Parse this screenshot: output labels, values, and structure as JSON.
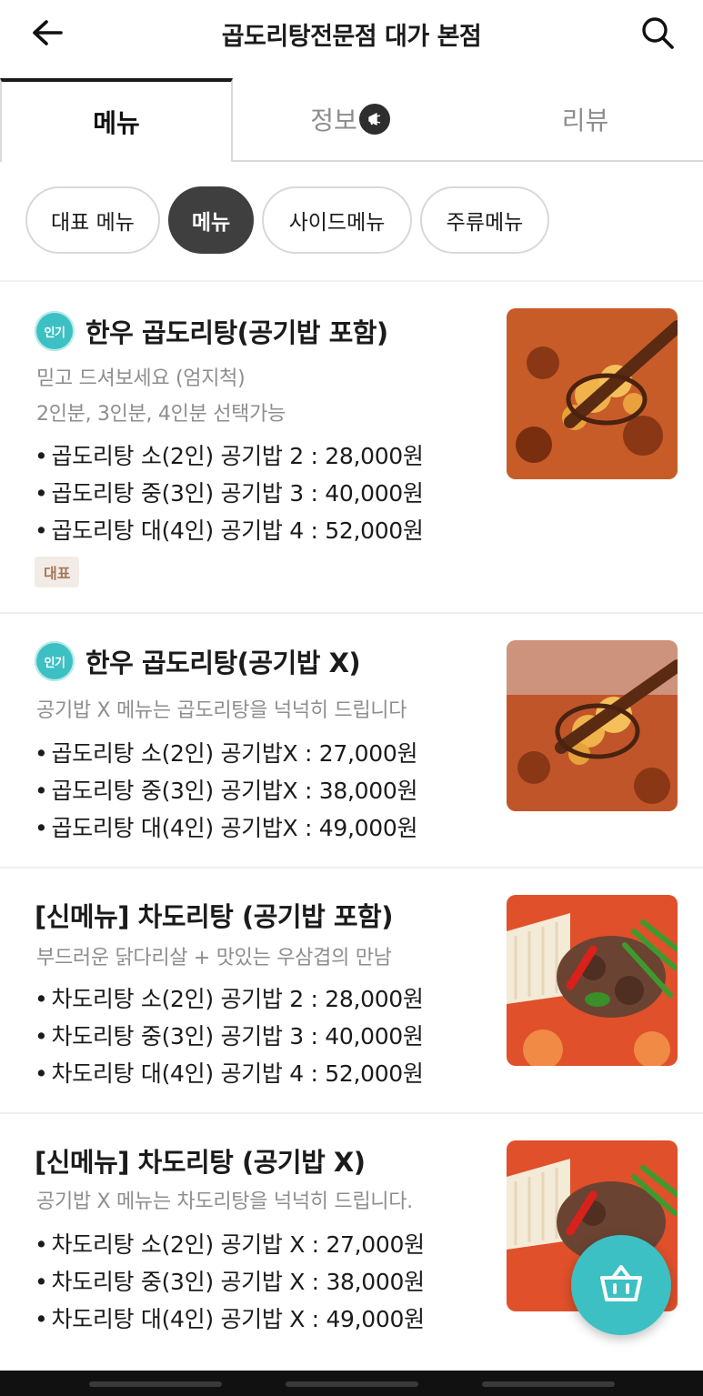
{
  "header": {
    "title": "곱도리탕전문점 대가 본점",
    "back_icon": "arrow-left-icon",
    "search_icon": "search-icon"
  },
  "tabs": [
    {
      "label": "메뉴",
      "active": true
    },
    {
      "label": "정보",
      "icon": "megaphone-icon",
      "active": false
    },
    {
      "label": "리뷰",
      "active": false
    }
  ],
  "categories": [
    {
      "label": "대표 메뉴",
      "active": false
    },
    {
      "label": "메뉴",
      "active": true
    },
    {
      "label": "사이드메뉴",
      "active": false
    },
    {
      "label": "주류메뉴",
      "active": false
    }
  ],
  "menu_items": [
    {
      "badge": "인기",
      "name": "한우 곱도리탕(공기밥 포함)",
      "descriptions": [
        "믿고 드셔보세요 (엄지척)",
        "2인분, 3인분, 4인분 선택가능"
      ],
      "prices": [
        "곱도리탕 소(2인) 공기밥 2 : 28,000원",
        "곱도리탕 중(3인) 공기밥 3 : 40,000원",
        "곱도리탕 대(4인) 공기밥 4 : 52,000원"
      ],
      "tag": "대표"
    },
    {
      "badge": "인기",
      "name": "한우 곱도리탕(공기밥 X)",
      "descriptions": [
        "공기밥 X 메뉴는 곱도리탕을 넉넉히 드립니다"
      ],
      "prices": [
        "곱도리탕 소(2인) 공기밥X : 27,000원",
        "곱도리탕 중(3인) 공기밥X : 38,000원",
        "곱도리탕 대(4인) 공기밥X : 49,000원"
      ]
    },
    {
      "name": "[신메뉴] 차도리탕 (공기밥 포함)",
      "descriptions": [
        "부드러운 닭다리살 + 맛있는 우삼겹의 만남"
      ],
      "prices": [
        "차도리탕 소(2인) 공기밥 2 : 28,000원",
        "차도리탕 중(3인) 공기밥 3 : 40,000원",
        "차도리탕 대(4인) 공기밥 4 : 52,000원"
      ]
    },
    {
      "name": "[신메뉴] 차도리탕 (공기밥 X)",
      "descriptions": [
        "공기밥 X 메뉴는 차도리탕을 넉넉히 드립니다."
      ],
      "prices": [
        "차도리탕 소(2인) 공기밥 X : 27,000원",
        "차도리탕 중(3인) 공기밥 X : 38,000원",
        "차도리탕 대(4인) 공기밥 X : 49,000원"
      ]
    }
  ],
  "cart_button": {
    "icon": "basket-icon"
  },
  "colors": {
    "accent": "#3cc0c3",
    "active_chip": "#3f3f3f",
    "tag_bg": "#f3ece6",
    "tag_text": "#a4775a"
  }
}
